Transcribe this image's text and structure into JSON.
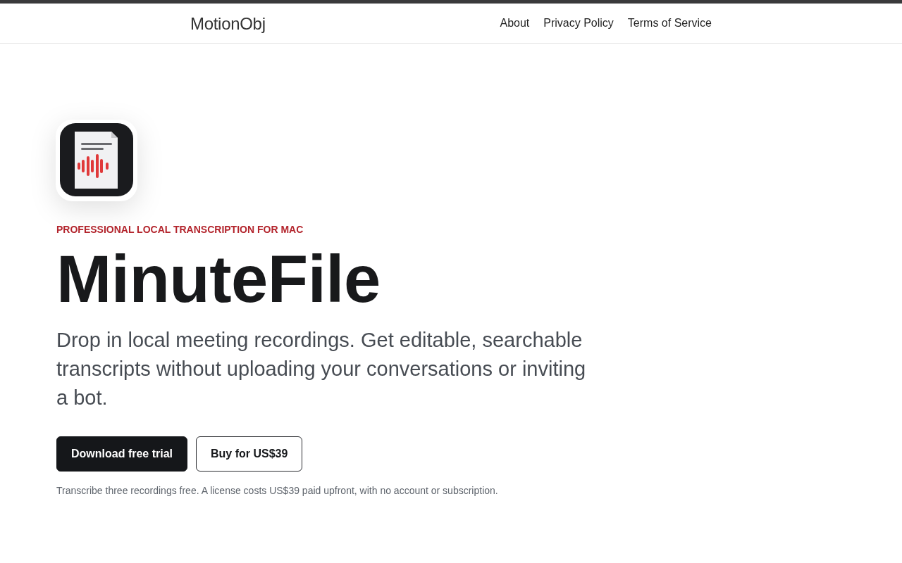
{
  "top_nav": {
    "brand": "MotionObj",
    "links": [
      "About",
      "Privacy Policy",
      "Terms of Service"
    ]
  },
  "hero": {
    "eyebrow": "PROFESSIONAL LOCAL TRANSCRIPTION FOR MAC",
    "title": "MinuteFile",
    "description": "Drop in local meeting recordings. Get editable, searchable transcripts without uploading your conversations or inviting a bot.",
    "buttons": [
      {
        "label": "Download free trial",
        "kind": "primary"
      },
      {
        "label": "Buy for US$39",
        "kind": "secondary"
      }
    ],
    "note": "Transcribe three recordings free. A license costs US$39 paid upfront, with no account or subscription."
  }
}
